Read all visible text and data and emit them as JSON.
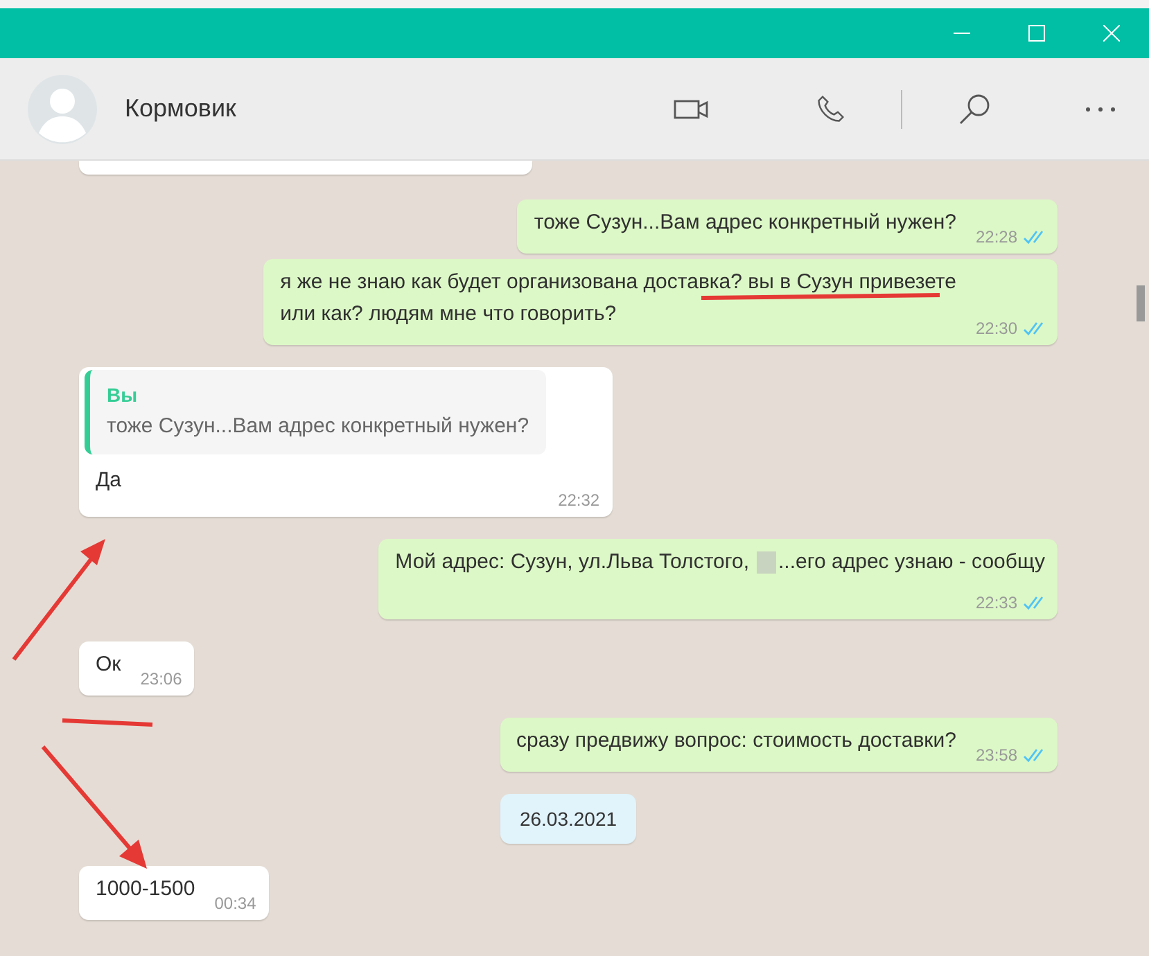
{
  "header": {
    "contact_name": "Кормовик"
  },
  "messages": [
    {
      "kind": "cut"
    },
    {
      "kind": "text",
      "outgoing": true,
      "text": "тоже Сузун...Вам адрес конкретный нужен?",
      "time": "22:28",
      "read": true
    },
    {
      "kind": "lines",
      "outgoing": true,
      "lines": [
        "я же не знаю как будет организована доставка? вы в Сузун привезете",
        "или как? людям мне что говорить?"
      ],
      "time": "22:30",
      "read": true
    },
    {
      "kind": "reply",
      "outgoing": false,
      "quote_author": "Вы",
      "quote_text": "тоже Сузун...Вам адрес конкретный нужен?",
      "text": "Да",
      "time": "22:32"
    },
    {
      "kind": "redacted",
      "outgoing": true,
      "text_before": "Мой адрес: Сузун, ул.Льва Толстого,",
      "text_after": "...его адрес узнаю - сообщу",
      "time": "22:33",
      "read": true
    },
    {
      "kind": "text",
      "outgoing": false,
      "text": "Ок",
      "time": "23:06"
    },
    {
      "kind": "text",
      "outgoing": true,
      "text": "сразу предвижу вопрос: стоимость доставки?",
      "time": "23:58",
      "read": true
    },
    {
      "kind": "date",
      "text": "26.03.2021"
    },
    {
      "kind": "text",
      "outgoing": false,
      "text": "1000-1500",
      "time": "00:34"
    }
  ]
}
